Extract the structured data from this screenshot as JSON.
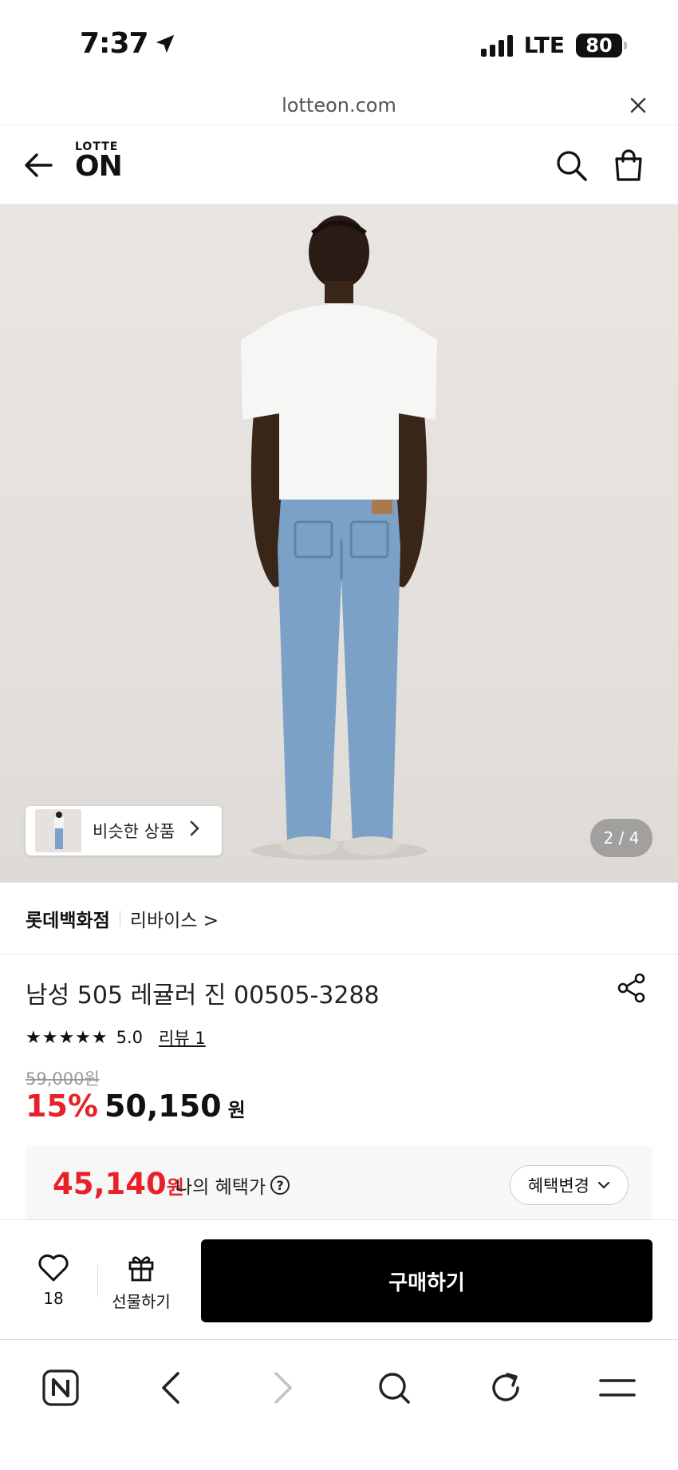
{
  "status_bar": {
    "time": "7:37",
    "network": "LTE",
    "battery": "80"
  },
  "browser": {
    "url": "lotteon.com"
  },
  "header": {
    "logo_top": "LOTTE",
    "logo_bottom": "ON"
  },
  "gallery": {
    "similar_label": "비슷한 상품",
    "page_indicator": "2 / 4"
  },
  "brand": {
    "store": "롯데백화점",
    "name": "리바이스 >"
  },
  "product": {
    "title": "남성 505 레귤러 진 00505-3288",
    "rating": "5.0",
    "stars_filled": 5,
    "review_link": "리뷰 1",
    "original_price": "59,000원",
    "discount": "15%",
    "sale_price": "50,150",
    "won": "원"
  },
  "benefit": {
    "price": "45,140",
    "won": "원",
    "label": "나의 혜택가",
    "help": "?",
    "change_label": "혜택변경"
  },
  "actions": {
    "like_count": "18",
    "gift_label": "선물하기",
    "buy_label": "구매하기"
  },
  "colors": {
    "accent_red": "#e8202a",
    "buy_button": "#000000"
  }
}
